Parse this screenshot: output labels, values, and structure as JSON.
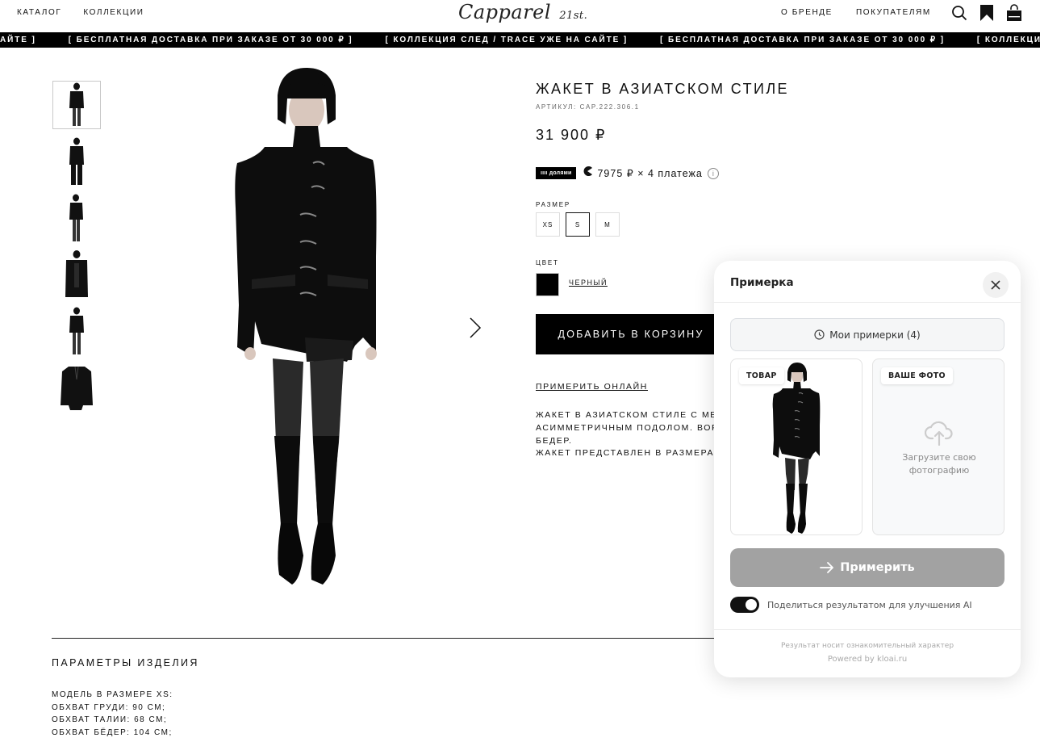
{
  "header": {
    "nav_left": [
      "КАТАЛОГ",
      "КОЛЛЕКЦИИ"
    ],
    "logo": "Capparel",
    "logo_suffix": "21st.",
    "nav_right": [
      "О БРЕНДЕ",
      "ПОКУПАТЕЛЯМ"
    ],
    "icons": [
      "search-icon",
      "bookmark-icon",
      "bag-icon"
    ]
  },
  "ticker": {
    "items": [
      "АЙТЕ ]",
      "[ БЕСПЛАТНАЯ ДОСТАВКА ПРИ ЗАКАЗЕ ОТ 30 000 ₽ ]",
      "[ КОЛЛЕКЦИЯ СЛЕД / TRACE УЖЕ НА САЙТЕ ]",
      "[ БЕСПЛАТНАЯ ДОСТАВКА ПРИ ЗАКАЗЕ ОТ 30 000 ₽ ]",
      "[ КОЛЛЕКЦИЯ"
    ]
  },
  "gallery": {
    "thumbnail_count": 6,
    "active_index": 0
  },
  "product": {
    "title": "ЖАКЕТ В АЗИАТСКОМ СТИЛЕ",
    "sku": "АРТИКУЛ: CAP.222.306.1",
    "price": "31 900 ₽",
    "installment_badge": "ıııı долями",
    "installment_text": "7975 ₽ × 4 платежа",
    "size_label": "РАЗМЕР",
    "sizes": [
      "XS",
      "S",
      "M"
    ],
    "selected_size": "S",
    "color_label": "ЦВЕТ",
    "color_name": "ЧЕРНЫЙ",
    "color_hex": "#000000",
    "add_to_cart": "ДОБАВИТЬ В КОРЗИНУ",
    "try_online": "ПРИМЕРИТЬ ОНЛАЙН",
    "description": [
      "ЖАКЕТ В АЗИАТСКОМ СТИЛЕ С МЕТ",
      "АСИММЕТРИЧНЫМ ПОДОЛОМ. ВОРО",
      "БЕДЕР.",
      "ЖАКЕТ ПРЕДСТАВЛЕН В РАЗМЕРАХ"
    ]
  },
  "params": {
    "title": "ПАРАМЕТРЫ ИЗДЕЛИЯ",
    "lines": [
      "МОДЕЛЬ В РАЗМЕРЕ XS:",
      "ОБХВАТ ГРУДИ: 90 СМ;",
      "ОБХВАТ ТАЛИИ: 68 СМ;",
      "ОБХВАТ БЁДЕР: 104 СМ;"
    ]
  },
  "widget": {
    "title": "Примерка",
    "history": "Мои примерки (4)",
    "product_badge": "ТОВАР",
    "photo_badge": "ВАШЕ ФОТО",
    "upload_text_1": "Загрузите свою",
    "upload_text_2": "фотографию",
    "try_button": "Примерить",
    "share_label": "Поделиться результатом для улучшения AI",
    "share_enabled": true,
    "disclaimer": "Результат носит ознакомительный характер",
    "powered": "Powered by kloai.ru"
  }
}
